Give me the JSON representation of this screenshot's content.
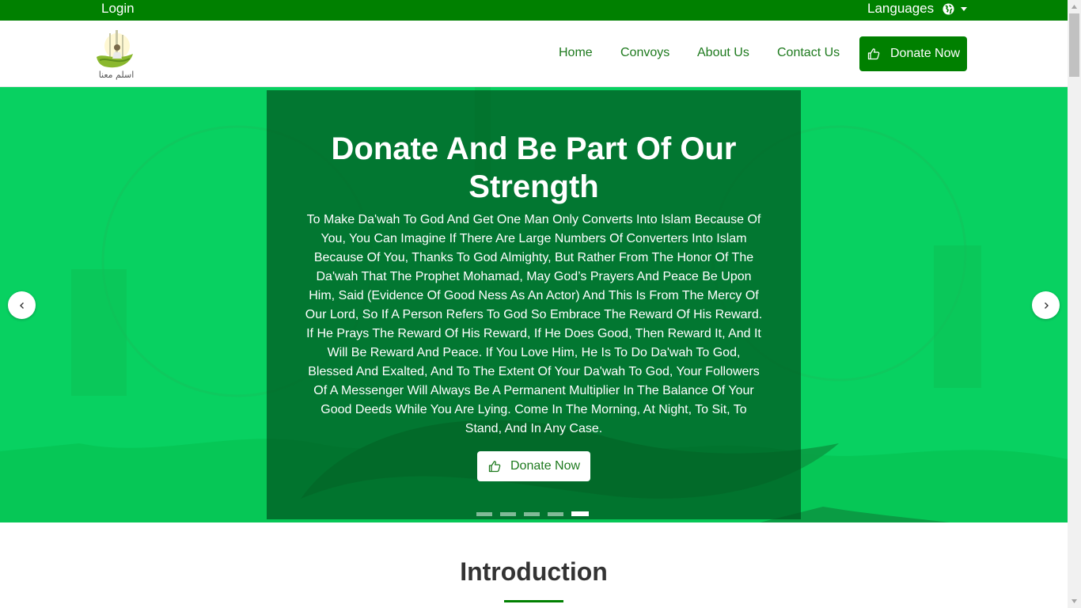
{
  "topbar": {
    "login": "Login",
    "languages": "Languages"
  },
  "nav": {
    "logo_text": "اسلم معنا",
    "items": [
      {
        "label": "Home"
      },
      {
        "label": "Convoys"
      },
      {
        "label": "About Us"
      },
      {
        "label": "Contact Us"
      }
    ],
    "donate": "Donate Now"
  },
  "hero": {
    "title": "Donate And Be Part Of Our Strength",
    "text": "To Make Da'wah To God And Get One Man Only Converts Into Islam Because Of You, You Can Imagine If There Are Large Numbers Of Converters Into Islam Because Of You, Thanks To God Almighty, But Rather From The Honor Of The Da'wah That The Prophet Mohamad, May God’s Prayers And Peace Be Upon Him, Said (Evidence Of Good Ness As An Actor) And This Is From The Mercy Of Our Lord, So If A Person Refers To God So Embrace The Reward Of His Reward. If He Prays The Reward Of His Reward, If He Does Good, Then Reward It, And It Will Be Reward And Peace. If You Love Him, He Is To Do Da'wah To God, Blessed And Exalted, And To The Extent Of Your Da'wah To God, Your Followers Of A Messenger Will Always Be A Permanent Multiplier In The Balance Of Your Good Deeds While You Are Lying. Come In The Morning, At Night, To Sit, To Stand, And In Any Case.",
    "donate": "Donate Now",
    "slide_count": 5,
    "active_slide": 5
  },
  "intro": {
    "title": "Introduction"
  },
  "colors": {
    "brand_green": "#008000",
    "hero_green": "#08d161",
    "overlay_green": "#00551e"
  }
}
